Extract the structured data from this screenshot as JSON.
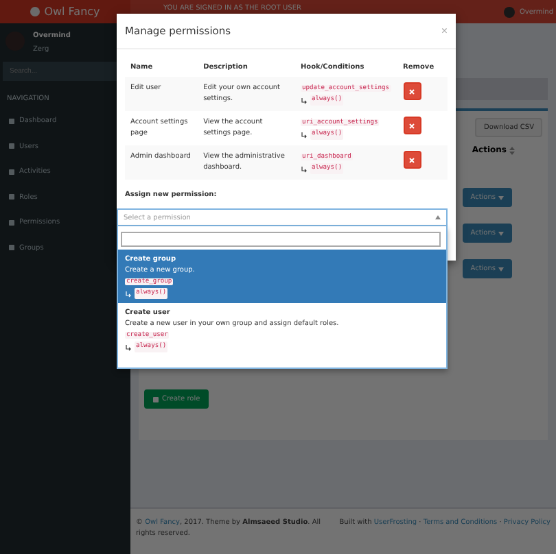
{
  "header": {
    "logo": "Owl Fancy",
    "notice": "YOU ARE SIGNED IN AS THE ROOT USER",
    "user": "Overmind"
  },
  "sidebar": {
    "user_name": "Overmind",
    "user_group": "Zerg",
    "search": {
      "placeholder": "Search..."
    },
    "section": "NAVIGATION",
    "items": [
      {
        "label": "Dashboard",
        "selected": false
      },
      {
        "label": "Users",
        "selected": false
      },
      {
        "label": "Activities",
        "selected": false
      },
      {
        "label": "Roles",
        "selected": false
      },
      {
        "label": "Permissions",
        "selected": false
      },
      {
        "label": "Groups",
        "selected": false
      }
    ]
  },
  "content": {
    "download_button": "Download CSV",
    "actions_column": "Actions",
    "action_buttons": [
      "Actions",
      "Actions",
      "Actions"
    ],
    "create_button": "Create role"
  },
  "footer": {
    "left": [
      {
        "kind": "text",
        "text": "© "
      },
      {
        "kind": "link",
        "text": "Owl Fancy"
      },
      {
        "kind": "text",
        "text": ", 2017. Theme by "
      },
      {
        "kind": "bold",
        "text": "Almsaeed Studio"
      },
      {
        "kind": "text",
        "text": ". All rights reserved."
      }
    ],
    "right": [
      {
        "kind": "text",
        "text": "Built with "
      },
      {
        "kind": "link",
        "text": "UserFrosting"
      },
      {
        "kind": "text",
        "text": " · "
      },
      {
        "kind": "link",
        "text": "Terms and Conditions"
      },
      {
        "kind": "text",
        "text": " · "
      },
      {
        "kind": "link",
        "text": "Privacy Policy"
      }
    ]
  },
  "modal": {
    "title": "Manage permissions",
    "close": "×",
    "columns": [
      "Name",
      "Description",
      "Hook/Conditions",
      "Remove"
    ],
    "rows": [
      {
        "name": "Edit user",
        "description": "Edit your own account settings.",
        "hook": "update_account_settings",
        "condition": "always()"
      },
      {
        "name": "Account settings page",
        "description": "View the account settings page.",
        "hook": "uri_account_settings",
        "condition": "always()"
      },
      {
        "name": "Admin dashboard",
        "description": "View the administrative dashboard.",
        "hook": "uri_dashboard",
        "condition": "always()"
      }
    ],
    "assign_label": "Assign new permission:",
    "select": {
      "placeholder": "Select a permission",
      "expanded": true
    },
    "options": [
      {
        "name": "Create group",
        "description": "Create a new group.",
        "hook": "create_group",
        "condition": "always()",
        "selected": true
      },
      {
        "name": "Create user",
        "description": "Create a new user in your own group and assign default roles.",
        "hook": "create_user",
        "condition": "always()",
        "selected": false
      }
    ]
  }
}
